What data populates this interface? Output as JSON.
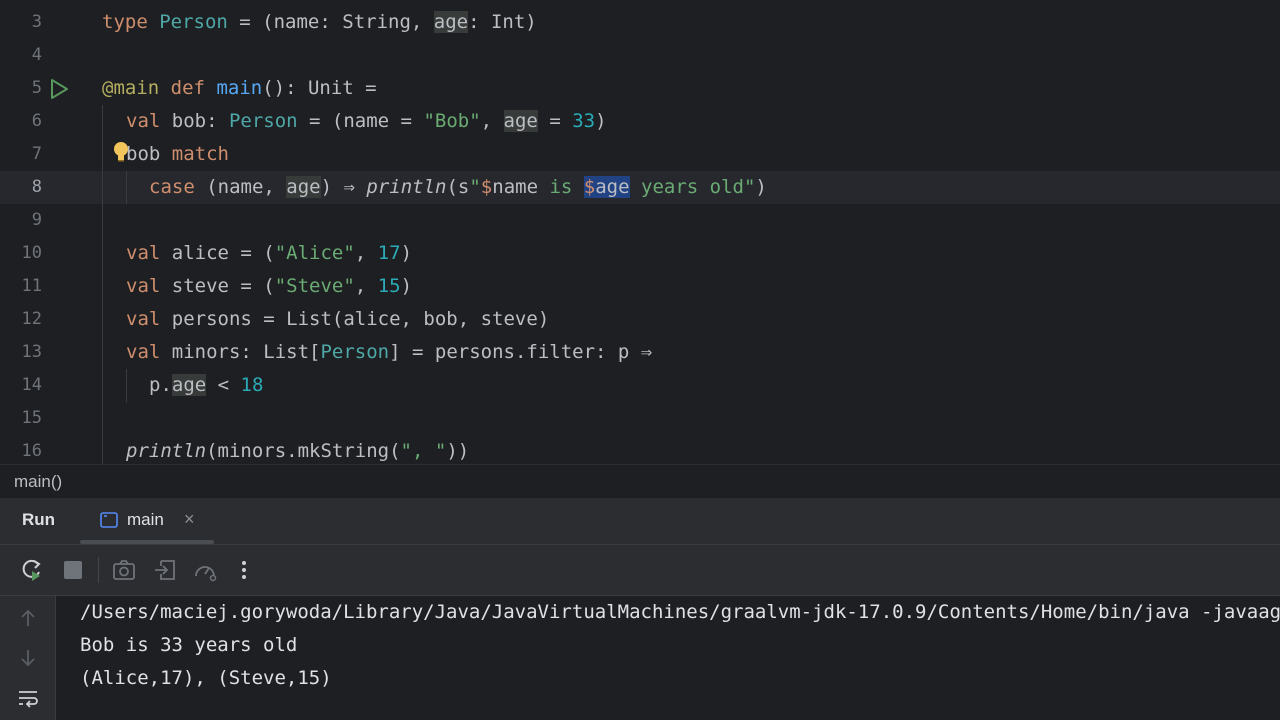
{
  "editor": {
    "lines": [
      {
        "num": "3"
      },
      {
        "num": "4"
      },
      {
        "num": "5"
      },
      {
        "num": "6"
      },
      {
        "num": "7"
      },
      {
        "num": "8"
      },
      {
        "num": "9"
      },
      {
        "num": "10"
      },
      {
        "num": "11"
      },
      {
        "num": "12"
      },
      {
        "num": "13"
      },
      {
        "num": "14"
      },
      {
        "num": "15"
      },
      {
        "num": "16"
      }
    ],
    "code": {
      "l3": [
        "type",
        " ",
        "Person",
        " = (name: String, ",
        "age",
        ": Int)"
      ],
      "l5": [
        "@main",
        " ",
        "def",
        " ",
        "main",
        "(): Unit ="
      ],
      "l6": [
        "val",
        " bob: ",
        "Person",
        " = (name = ",
        "\"Bob\"",
        ", ",
        "age",
        " = ",
        "33",
        ")"
      ],
      "l7": [
        "bob",
        " ",
        "match"
      ],
      "l8": [
        "case",
        " (name, ",
        "age",
        ") ⇒ ",
        "println",
        "(s",
        "\"",
        "$",
        "name",
        " is ",
        "$",
        "age",
        " years old\"",
        ")"
      ],
      "l10": [
        "val",
        " alice = (",
        "\"Alice\"",
        ", ",
        "17",
        ")"
      ],
      "l11": [
        "val",
        " steve = (",
        "\"Steve\"",
        ", ",
        "15",
        ")"
      ],
      "l12": [
        "val",
        " persons = List(alice, bob, steve)"
      ],
      "l13": [
        "val",
        " minors: List[",
        "Person",
        "] = persons.filter: p ⇒"
      ],
      "l14": [
        "p.",
        "age",
        " < ",
        "18"
      ],
      "l16": [
        "println",
        "(minors.mkString(",
        "\", \"",
        "))"
      ]
    }
  },
  "breadcrumb": {
    "label": "main()"
  },
  "run_panel": {
    "title": "Run",
    "tab_label": "main",
    "tab_close": "×"
  },
  "toolbar_icons": [
    "rerun-icon",
    "stop-icon",
    "camera-icon",
    "restore-layout-icon",
    "profiler-icon",
    "more-icon"
  ],
  "console": {
    "lines": [
      "/Users/maciej.gorywoda/Library/Java/JavaVirtualMachines/graalvm-jdk-17.0.9/Contents/Home/bin/java -javaagent:/Applications/IntelliJ",
      "Bob is 33 years old",
      "(Alice,17), (Steve,15)"
    ]
  },
  "colors": {
    "background": "#1e1f22",
    "panel": "#2b2d30",
    "keyword": "#cf8e6d",
    "type": "#4fa8a8",
    "string": "#6aab73",
    "number": "#2aacb8",
    "function": "#56a8f5",
    "annotation": "#b3ae60"
  }
}
